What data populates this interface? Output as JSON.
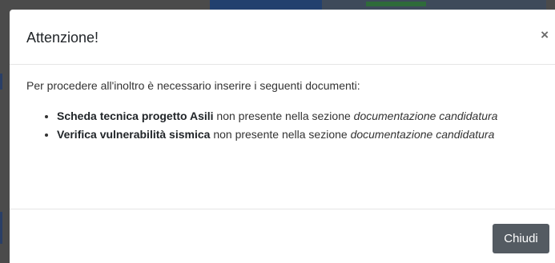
{
  "modal": {
    "title": "Attenzione!",
    "close_icon": "close-icon",
    "close_glyph": "×",
    "intro": "Per procedere all'inoltro è necessario inserire i seguenti documenti:",
    "documents": [
      {
        "name": "Scheda tecnica progetto Asili",
        "status": " non presente nella sezione ",
        "section": "documentazione candidatura"
      },
      {
        "name": "Verifica vulnerabilità sismica",
        "status": " non presente nella sezione ",
        "section": "documentazione candidatura"
      }
    ],
    "close_button_label": "Chiudi"
  },
  "colors": {
    "backdrop": "#4b4b4b",
    "button": "#545b62",
    "text": "#333333"
  }
}
